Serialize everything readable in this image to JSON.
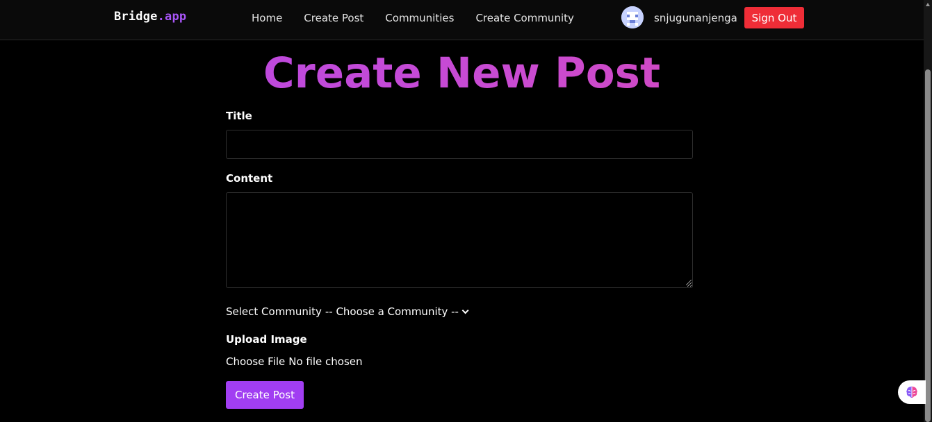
{
  "brand": {
    "name": "Bridge",
    "tld": ".app"
  },
  "nav": {
    "items": [
      {
        "label": "Home"
      },
      {
        "label": "Create Post"
      },
      {
        "label": "Communities"
      },
      {
        "label": "Create Community"
      }
    ]
  },
  "user": {
    "username": "snjugunanjenga",
    "avatar_icon": "pixel-avatar-icon"
  },
  "signout_label": "Sign Out",
  "page": {
    "title": "Create New Post"
  },
  "form": {
    "title_label": "Title",
    "title_value": "",
    "content_label": "Content",
    "content_value": "",
    "community_label": "Select Community",
    "community_selected": "-- Choose a Community --",
    "upload_label": "Upload Image",
    "file_button": "Choose File",
    "file_status": "No file chosen",
    "submit_label": "Create Post"
  },
  "colors": {
    "accent": "#a13ef2",
    "brand_tld": "#a855f7",
    "signout": "#ef2d37",
    "title_gradient": [
      "#b347e8",
      "#d946b0"
    ]
  },
  "extension": {
    "icon": "brain-icon"
  }
}
